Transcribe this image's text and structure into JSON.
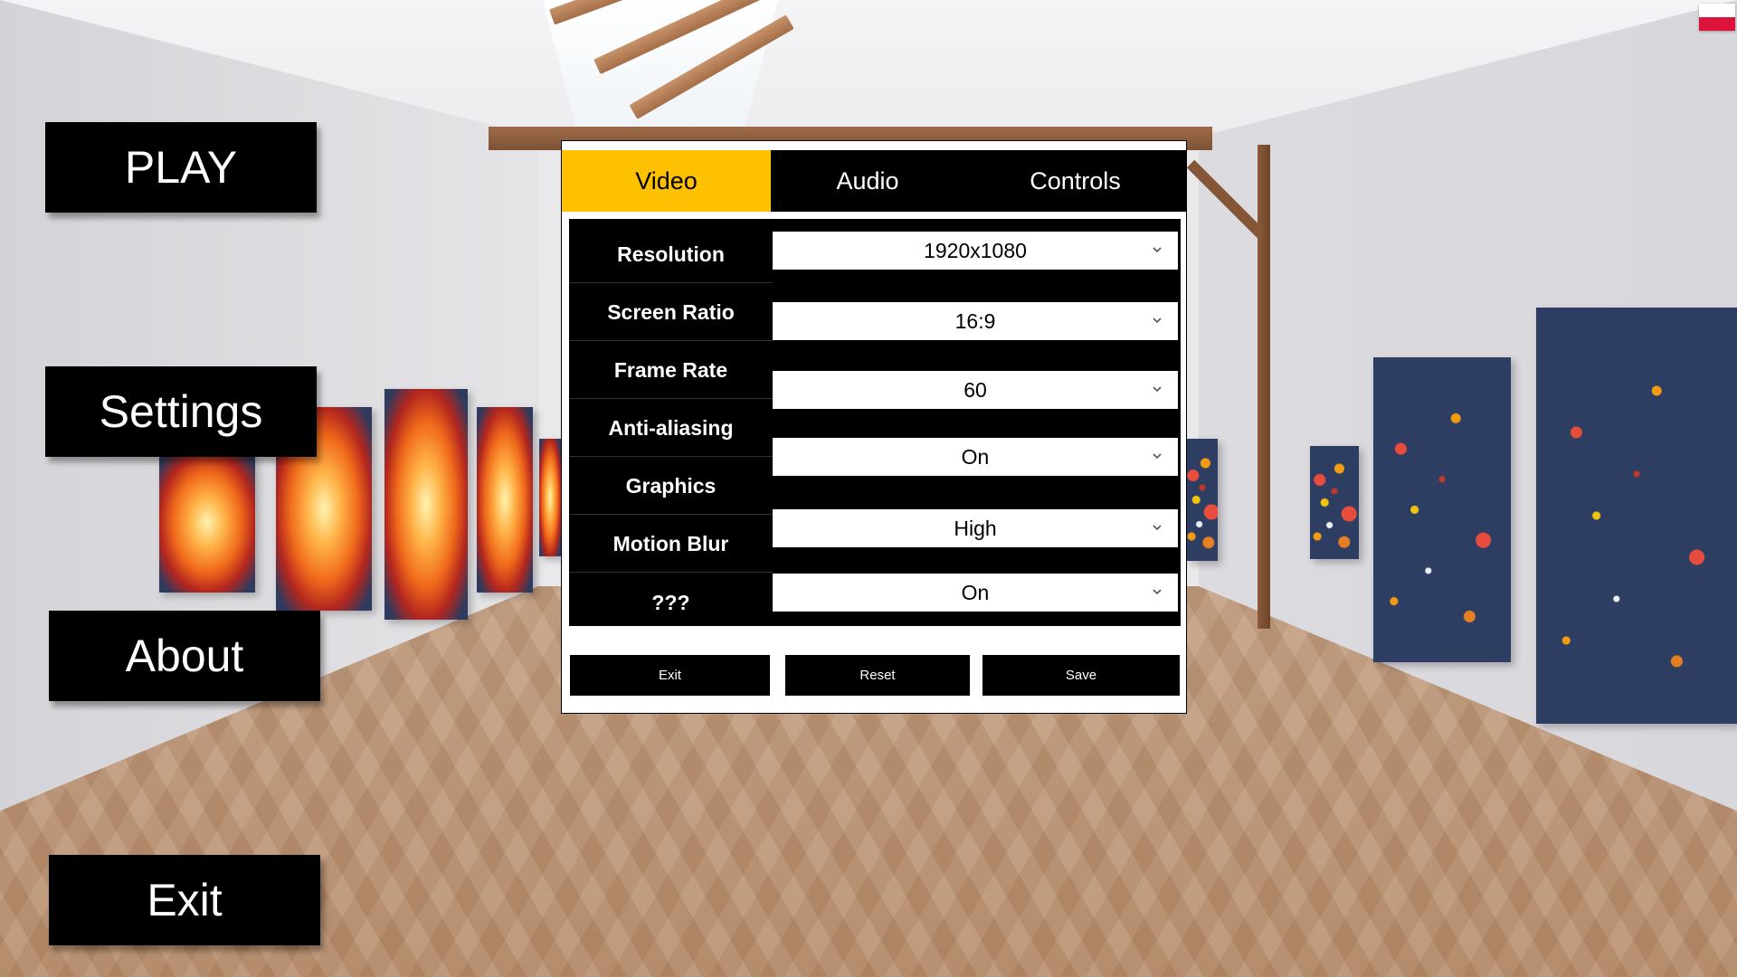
{
  "main_menu": {
    "play_label": "PLAY",
    "settings_label": "Settings",
    "about_label": "About",
    "exit_label": "Exit"
  },
  "language_flag": {
    "icon": "poland-flag-icon",
    "colors": [
      "#ffffff",
      "#dc143c"
    ]
  },
  "settings": {
    "tabs": [
      {
        "label": "Video",
        "active": true
      },
      {
        "label": "Audio",
        "active": false
      },
      {
        "label": "Controls",
        "active": false
      }
    ],
    "labels": [
      "Resolution",
      "Screen Ratio",
      "Frame Rate",
      "Anti-aliasing",
      "Graphics",
      "Motion Blur",
      "???"
    ],
    "dropdowns": [
      "1920x1080",
      "16:9",
      "60",
      "On",
      "High",
      "On"
    ],
    "buttons": {
      "exit": "Exit",
      "reset": "Reset",
      "save": "Save"
    }
  },
  "colors": {
    "accent": "#ffc000",
    "panel": "#000000",
    "text_light": "#ffffff"
  }
}
